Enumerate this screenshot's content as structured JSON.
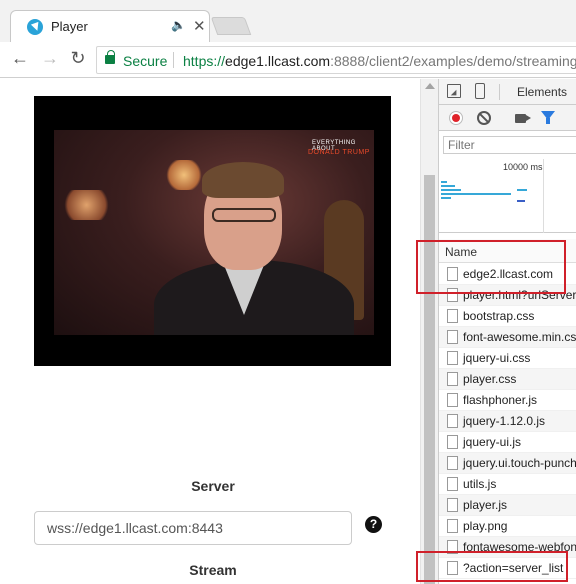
{
  "browser": {
    "tab_title": "Player",
    "audio_glyph": "🔈",
    "close_glyph": "✕",
    "back_glyph": "←",
    "forward_glyph": "→",
    "reload_glyph": "↻",
    "secure_label": "Secure",
    "url_scheme": "https://",
    "url_host": "edge1.llcast.com",
    "url_rest": ":8888/client2/examples/demo/streaming"
  },
  "video": {
    "caption_top": "EVERYTHING ABOUT",
    "caption_bottom": "DONALD TRUMP"
  },
  "form": {
    "server_label": "Server",
    "server_value": "wss://edge1.llcast.com:8443",
    "help_glyph": "?",
    "stream_label": "Stream"
  },
  "devtools": {
    "elements_tab": "Elements",
    "filter_placeholder": "Filter",
    "timeline_label": "10000 ms",
    "name_header": "Name",
    "requests": [
      "edge2.llcast.com",
      "player.html?urlServer=",
      "bootstrap.css",
      "font-awesome.min.css",
      "jquery-ui.css",
      "player.css",
      "flashphoner.js",
      "jquery-1.12.0.js",
      "jquery-ui.js",
      "jquery.ui.touch-punch",
      "utils.js",
      "player.js",
      "play.png",
      "fontawesome-webfont",
      "?action=server_list"
    ]
  },
  "colors": {
    "secure_green": "#0b8043",
    "highlight_red": "#d0202a",
    "record_red": "#e0232a",
    "filter_blue": "#2a7ade",
    "timeline_blue": "#36a8d8"
  }
}
